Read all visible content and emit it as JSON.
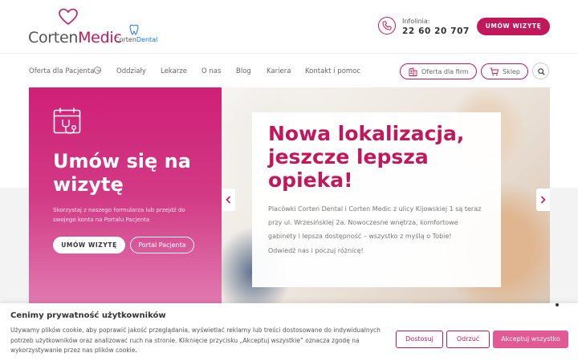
{
  "brand": {
    "logo_main_prefix": "Corten",
    "logo_main_suffix": "Medic",
    "logo_dental_prefix": "Corten",
    "logo_dental_suffix": "Dental",
    "accent": "#c2185b",
    "dental_blue": "#1976d2"
  },
  "header": {
    "infolinia_label": "Infolinia:",
    "infolinia_number": "22 60 20 707",
    "cta_label": "UMÓW WIZYTĘ"
  },
  "nav": {
    "items": [
      {
        "label": "Oferta dla Pacjenta"
      },
      {
        "label": "Oddziały"
      },
      {
        "label": "Lekarze"
      },
      {
        "label": "O nas"
      },
      {
        "label": "Blog"
      },
      {
        "label": "Kariera"
      },
      {
        "label": "Kontakt i pomoc"
      }
    ],
    "firm_label": "Oferta dla firm",
    "shop_label": "Sklep"
  },
  "hero": {
    "panel_title": "Umów się na wizytę",
    "panel_desc": "Skorzystaj z naszego formularza lub przejdź do swojego konta na Portalu Pacjenta",
    "btn_umow": "UMÓW WIZYTĘ",
    "btn_portal": "Portal Pacjenta",
    "card_title": "Nowa lokalizacja, jeszcze lepsza opieka!",
    "card_desc": "Placówki Corten Dental i Corten Medic z ulicy Kijowskiej 1 są teraz przy ul. Wrzesińskiej 2a. Nowoczesne wnętrza, komfortowe gabinety i lepsza dostępność – wszystko z myślą o Tobie!",
    "card_cta": "Odwiedź nas i poczuj różnicę!"
  },
  "cookie": {
    "title": "Cenimy prywatność użytkowników",
    "text": "Używamy plików cookie, aby poprawić jakość przeglądania, wyświetlać reklamy lub treści dostosowane do indywidualnych potrzeb użytkowników oraz analizować ruch na stronie. Kliknięcie przycisku „Akceptuj wszystkie” oznacza zgodę na wykorzystywanie przez nas plików cookie.",
    "btn_customize": "Dostosuj",
    "btn_reject": "Odrzuć",
    "btn_accept": "Akceptuj wszystko"
  },
  "icons": [
    "heart-logo-icon",
    "tooth-icon",
    "phone-icon",
    "accessibility-icon",
    "chevron-down-icon",
    "building-icon",
    "cart-icon",
    "search-icon",
    "calendar-stethoscope-icon",
    "chevron-left-icon",
    "chevron-right-icon"
  ]
}
